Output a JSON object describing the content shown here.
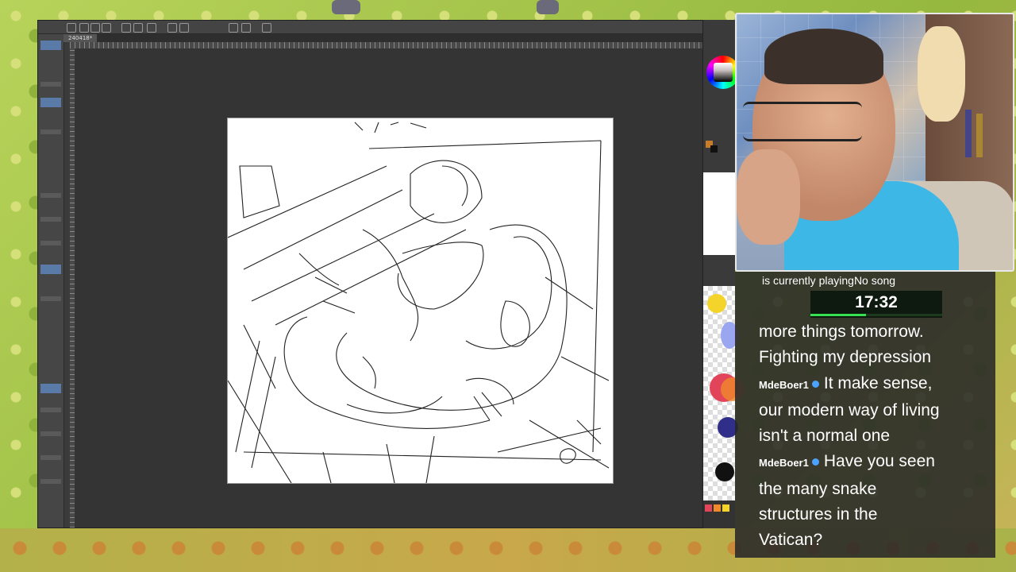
{
  "stream": {
    "now_playing": "is currently playingNo song",
    "timer": "17:32",
    "timer_progress": 0.42,
    "chat": [
      {
        "user": "",
        "text": "more things tomorrow."
      },
      {
        "user": "",
        "text": "Fighting my depression"
      },
      {
        "user": "MdeBoer1",
        "text": "It make sense,"
      },
      {
        "user": "",
        "text": "our modern way of living"
      },
      {
        "user": "",
        "text": "isn't a normal one"
      },
      {
        "user": "MdeBoer1",
        "text": "Have you seen"
      },
      {
        "user": "",
        "text": "the many snake"
      },
      {
        "user": "",
        "text": "structures in the"
      },
      {
        "user": "",
        "text": "Vatican?"
      }
    ]
  },
  "app": {
    "tab_label": "240418*",
    "main_color": "#c77c2a",
    "sub_color": "#111111"
  },
  "palette_colors": [
    "#f4d42a",
    "#9aa6f0",
    "#e2445a",
    "#f08a2a",
    "#2f2f8a",
    "#111111",
    "#e25a8a"
  ]
}
